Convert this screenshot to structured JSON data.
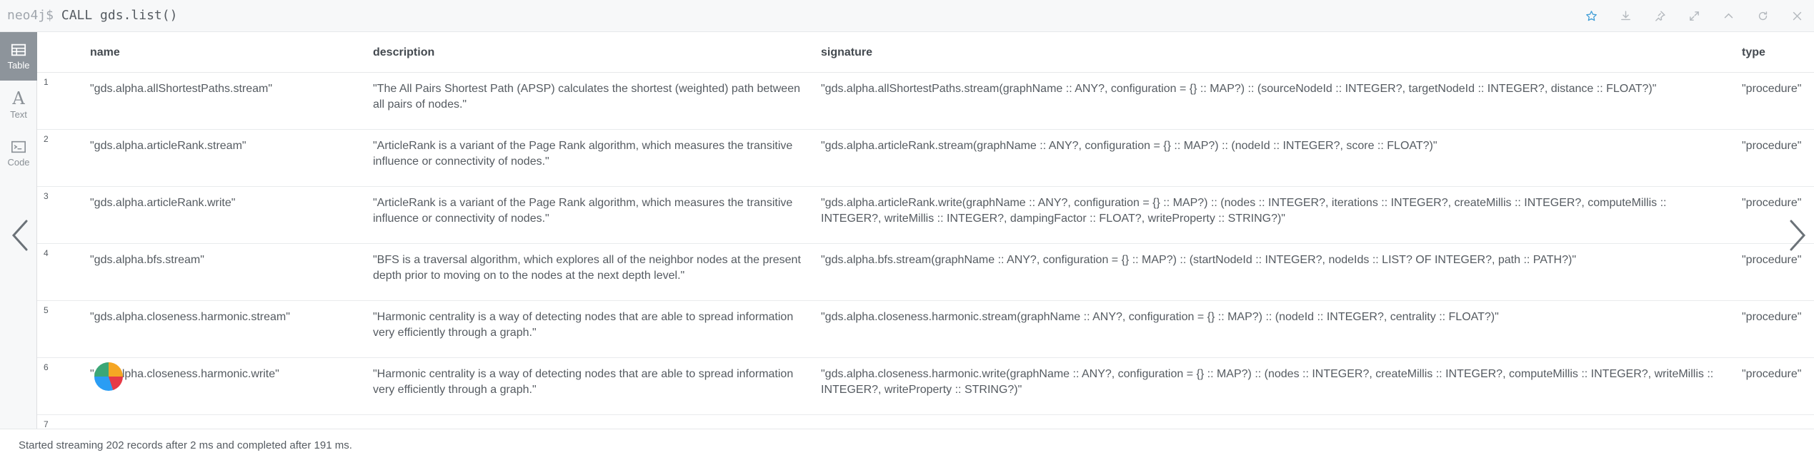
{
  "editor": {
    "prompt": "neo4j$",
    "query": "CALL gds.list()"
  },
  "toolbar_icons": [
    "star-icon",
    "download-icon",
    "pin-icon",
    "expand-icon",
    "collapse-up-icon",
    "refresh-icon",
    "close-icon"
  ],
  "sidebar": {
    "modes": [
      {
        "label": "Table",
        "icon": "table-icon",
        "active": true
      },
      {
        "label": "Text",
        "icon": "text-icon",
        "active": false
      },
      {
        "label": "Code",
        "icon": "code-icon",
        "active": false
      }
    ]
  },
  "table": {
    "columns": [
      "name",
      "description",
      "signature",
      "type"
    ],
    "rows": [
      {
        "num": "1",
        "name": "\"gds.alpha.allShortestPaths.stream\"",
        "description": "\"The All Pairs Shortest Path (APSP) calculates the shortest (weighted) path between all pairs of nodes.\"",
        "signature": "\"gds.alpha.allShortestPaths.stream(graphName :: ANY?, configuration = {} :: MAP?) :: (sourceNodeId :: INTEGER?, targetNodeId :: INTEGER?, distance :: FLOAT?)\"",
        "type": "\"procedure\""
      },
      {
        "num": "2",
        "name": "\"gds.alpha.articleRank.stream\"",
        "description": "\"ArticleRank is a variant of the Page Rank algorithm, which measures the transitive influence or connectivity of nodes.\"",
        "signature": "\"gds.alpha.articleRank.stream(graphName :: ANY?, configuration = {} :: MAP?) :: (nodeId :: INTEGER?, score :: FLOAT?)\"",
        "type": "\"procedure\""
      },
      {
        "num": "3",
        "name": "\"gds.alpha.articleRank.write\"",
        "description": "\"ArticleRank is a variant of the Page Rank algorithm, which measures the transitive influence or connectivity of nodes.\"",
        "signature": "\"gds.alpha.articleRank.write(graphName :: ANY?, configuration = {} :: MAP?) :: (nodes :: INTEGER?, iterations :: INTEGER?, createMillis :: INTEGER?, computeMillis :: INTEGER?, writeMillis :: INTEGER?, dampingFactor :: FLOAT?, writeProperty :: STRING?)\"",
        "type": "\"procedure\""
      },
      {
        "num": "4",
        "name": "\"gds.alpha.bfs.stream\"",
        "description": "\"BFS is a traversal algorithm, which explores all of the neighbor nodes at the present depth prior to moving on to the nodes at the next depth level.\"",
        "signature": "\"gds.alpha.bfs.stream(graphName :: ANY?, configuration = {} :: MAP?) :: (startNodeId :: INTEGER?, nodeIds :: LIST? OF INTEGER?, path :: PATH?)\"",
        "type": "\"procedure\""
      },
      {
        "num": "5",
        "name": "\"gds.alpha.closeness.harmonic.stream\"",
        "description": "\"Harmonic centrality is a way of detecting nodes that are able to spread information very efficiently through a graph.\"",
        "signature": "\"gds.alpha.closeness.harmonic.stream(graphName :: ANY?, configuration = {} :: MAP?) :: (nodeId :: INTEGER?, centrality :: FLOAT?)\"",
        "type": "\"procedure\""
      },
      {
        "num": "6",
        "name": "\"gds.alpha.closeness.harmonic.write\"",
        "description": "\"Harmonic centrality is a way of detecting nodes that are able to spread information very efficiently through a graph.\"",
        "signature": "\"gds.alpha.closeness.harmonic.write(graphName :: ANY?, configuration = {} :: MAP?) :: (nodes :: INTEGER?, createMillis :: INTEGER?, computeMillis :: INTEGER?, writeMillis :: INTEGER?, writeProperty :: STRING?)\"",
        "type": "\"procedure\""
      },
      {
        "num": "7",
        "name": "",
        "description": "",
        "signature": "",
        "type": ""
      }
    ]
  },
  "status": {
    "message": "Started streaming 202 records after 2 ms and completed after 191 ms."
  },
  "colors": {
    "accent": "#3d9cd6",
    "icon_gray": "#b4b9be",
    "active_mode_bg": "#8d949b"
  }
}
